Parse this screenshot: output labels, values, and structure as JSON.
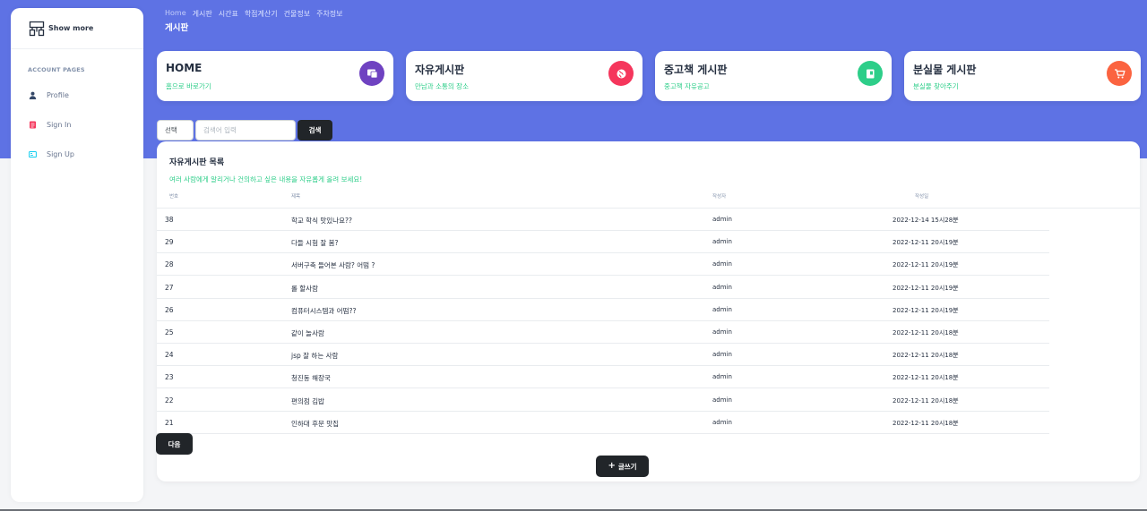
{
  "sidebar": {
    "brand_label": "Show more",
    "section_heading": "ACCOUNT PAGES",
    "items": [
      {
        "label": "Profile",
        "icon": "user-icon",
        "color": "#344767"
      },
      {
        "label": "Sign In",
        "icon": "document-icon",
        "color": "#f5365c"
      },
      {
        "label": "Sign Up",
        "icon": "card-icon",
        "color": "#11cdef"
      }
    ]
  },
  "header": {
    "breadcrumbs": [
      "Home",
      "게시판",
      "시간표",
      "학점계산기",
      "건물정보",
      "주차정보"
    ],
    "title": "게시판"
  },
  "cards": [
    {
      "title": "HOME",
      "subtitle": "홈으로 바로가기",
      "icon": "monitor-icon",
      "color": "#6f42c1"
    },
    {
      "title": "자유게시판",
      "subtitle": "만남과 소통의 장소",
      "icon": "globe-icon",
      "color": "#f5365c"
    },
    {
      "title": "중고책 게시판",
      "subtitle": "중고책 자유공고",
      "icon": "book-icon",
      "color": "#2dce89"
    },
    {
      "title": "분실물 게시판",
      "subtitle": "분실물 찾아주기",
      "icon": "cart-icon",
      "color": "#fb6340"
    }
  ],
  "search": {
    "select_value": "선택",
    "placeholder": "검색어 입력",
    "button_label": "검색"
  },
  "board": {
    "title": "자유게시판 목록",
    "description": "여러 사람에게 알리거나 건의하고 싶은 내용을 자유롭게 올려 보세요!",
    "columns": [
      "번호",
      "제목",
      "작성자",
      "작성일"
    ],
    "rows": [
      {
        "no": "38",
        "title": "학교 학식 맛있나요??",
        "author": "admin",
        "date": "2022-12-14 15시28분"
      },
      {
        "no": "29",
        "title": "다들 시험 잘 봄?",
        "author": "admin",
        "date": "2022-12-11 20시19분"
      },
      {
        "no": "28",
        "title": "서버구축 들어본 사람? 어떰 ?",
        "author": "admin",
        "date": "2022-12-11 20시19분"
      },
      {
        "no": "27",
        "title": "롤 할사람",
        "author": "admin",
        "date": "2022-12-11 20시19분"
      },
      {
        "no": "26",
        "title": "컴퓨터시스템과 어떰??",
        "author": "admin",
        "date": "2022-12-11 20시19분"
      },
      {
        "no": "25",
        "title": "같이 놀사람",
        "author": "admin",
        "date": "2022-12-11 20시18분"
      },
      {
        "no": "24",
        "title": "jsp 잘 하는 사람",
        "author": "admin",
        "date": "2022-12-11 20시18분"
      },
      {
        "no": "23",
        "title": "청진동 해장국",
        "author": "admin",
        "date": "2022-12-11 20시18분"
      },
      {
        "no": "22",
        "title": "편의점 김밥",
        "author": "admin",
        "date": "2022-12-11 20시18분"
      },
      {
        "no": "21",
        "title": "인하대 후문 맛집",
        "author": "admin",
        "date": "2022-12-11 20시18분"
      }
    ],
    "next_label": "다음",
    "write_label": "글쓰기"
  }
}
